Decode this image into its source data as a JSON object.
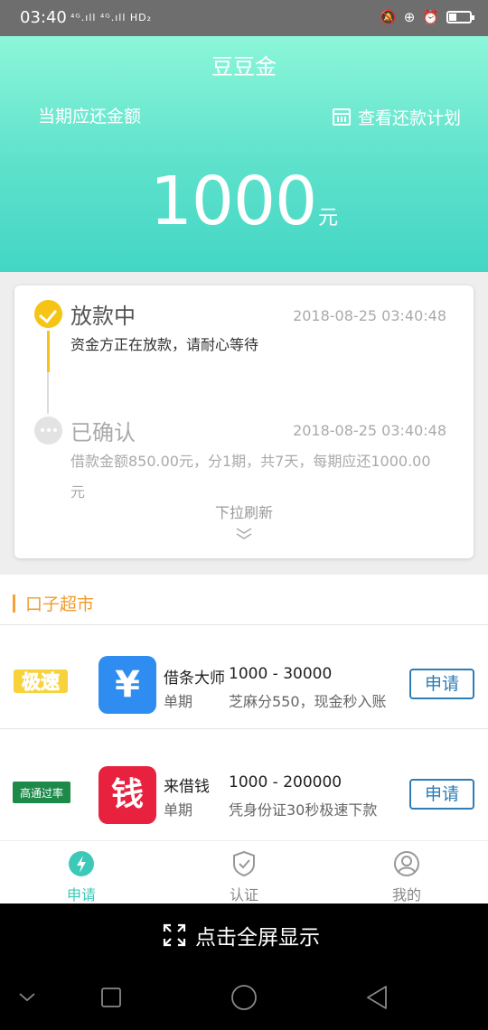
{
  "status_bar": {
    "time": "03:40",
    "network": "⁴ᴳ.ıll ⁴ᴳ.ıll HD₂",
    "battery_level": 0.35
  },
  "header": {
    "app_title": "豆豆金",
    "due_label": "当期应还金额",
    "plan_link": "查看还款计划",
    "amount": "1000",
    "unit": "元"
  },
  "status_card": {
    "steps": [
      {
        "title": "放款中",
        "time": "2018-08-25 03:40:48",
        "desc": "资金方正在放款，请耐心等待",
        "state": "active"
      },
      {
        "title": "已确认",
        "time": "2018-08-25 03:40:48",
        "desc_line1": "借款金额850.00元，分1期，共7天，每期应还1000.00",
        "desc_line2": "元",
        "state": "done"
      }
    ],
    "pull_refresh": "下拉刷新"
  },
  "market": {
    "title": "口子超市",
    "products": [
      {
        "badge": "极速",
        "icon_glyph": "¥",
        "name": "借条大师",
        "range": "1000 - 30000",
        "term": "单期",
        "desc": "芝麻分550，现金秒入账",
        "apply": "申请"
      },
      {
        "badge": "高通过率",
        "icon_glyph": "钱",
        "name": "来借钱",
        "range": "1000 - 200000",
        "term": "单期",
        "desc": "凭身份证30秒极速下款",
        "apply": "申请"
      }
    ]
  },
  "tabbar": {
    "tabs": [
      {
        "label": "申请",
        "icon": "lightning-icon",
        "active": true
      },
      {
        "label": "认证",
        "icon": "shield-check-icon",
        "active": false
      },
      {
        "label": "我的",
        "icon": "user-icon",
        "active": false
      }
    ]
  },
  "fullscreen_label": "点击全屏显示",
  "colors": {
    "header_gradient_top": "#8cf6d9",
    "header_gradient_bottom": "#43d6c4",
    "timeline_yellow": "#f5c414",
    "market_orange": "#f19b2c",
    "apply_blue": "#2d7eb6",
    "tab_active": "#3cc9b8"
  }
}
